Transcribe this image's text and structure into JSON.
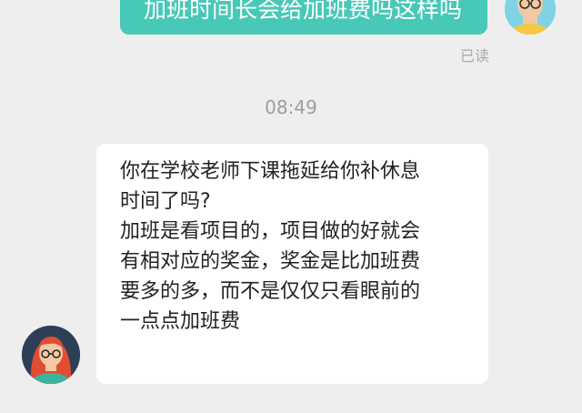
{
  "chat": {
    "sent_message": "加班时间长会给加班费吗这样吗",
    "read_status": "已读",
    "timestamp": "08:49",
    "received_message": {
      "lines": [
        "你在学校老师下课拖延给你补休息",
        "时间了吗?",
        "加班是看项目的，项目做的好就会",
        "有相对应的奖金，奖金是比加班费",
        "要多的多，而不是仅仅只看眼前的",
        "一点点加班费"
      ]
    }
  },
  "colors": {
    "sent_bubble": "#48c8b6",
    "received_bubble": "#ffffff",
    "background": "#eeeeee"
  }
}
